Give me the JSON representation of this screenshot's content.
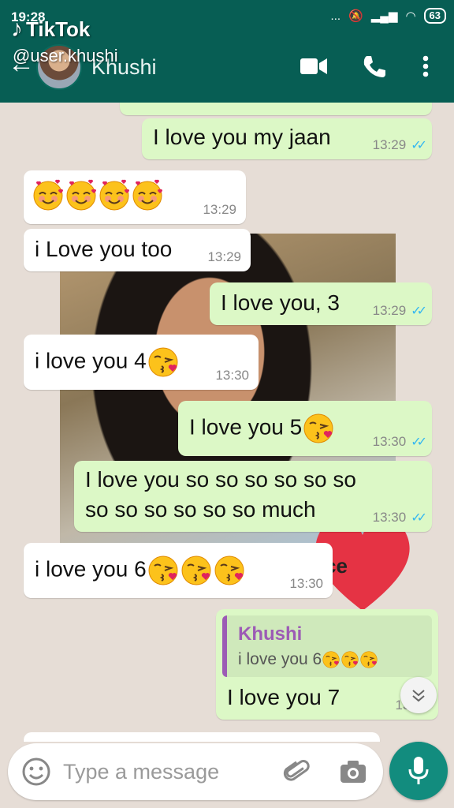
{
  "status_bar": {
    "time": "19:28",
    "signal": "...",
    "battery": "63"
  },
  "watermark": {
    "brand": "TikTok",
    "user": "@user.khushi"
  },
  "header": {
    "contact_name": "Khushi"
  },
  "photo_overlay_text": "ce",
  "messages": [
    {
      "direction": "out",
      "text": "I love you my jaan",
      "time": "13:29",
      "read": true
    },
    {
      "direction": "in",
      "text": "",
      "emoji": [
        "smiling-face-with-hearts",
        "smiling-face-with-hearts",
        "smiling-face-with-hearts",
        "smiling-face-with-hearts"
      ],
      "time": "13:29"
    },
    {
      "direction": "in",
      "text": "i Love you too",
      "time": "13:29"
    },
    {
      "direction": "out",
      "text": "I love you, 3",
      "time": "13:29",
      "read": true
    },
    {
      "direction": "in",
      "text": "i love you 4",
      "emoji": [
        "face-blowing-kiss"
      ],
      "time": "13:30"
    },
    {
      "direction": "out",
      "text": "I love you 5",
      "emoji": [
        "face-blowing-kiss"
      ],
      "time": "13:30",
      "read": true
    },
    {
      "direction": "out",
      "text_line1": "I love you so so so so so so",
      "text_line2": "so so so so so so much",
      "time": "13:30",
      "read": true
    },
    {
      "direction": "in",
      "text": "i love you 6",
      "emoji": [
        "face-blowing-kiss",
        "face-blowing-kiss",
        "face-blowing-kiss"
      ],
      "time": "13:30"
    },
    {
      "direction": "out",
      "quote_name": "Khushi",
      "quote_text": "i love you 6",
      "text": "I love you 7",
      "time": "13:30"
    }
  ],
  "input": {
    "placeholder": "Type a message"
  },
  "colors": {
    "header": "#075e54",
    "outgoing": "#dcf8c6",
    "incoming": "#ffffff",
    "accent": "#128c7e",
    "tick": "#34b7f1",
    "quote_bar": "#9c5bb5"
  },
  "icons": [
    "back-arrow-icon",
    "video-call-icon",
    "phone-icon",
    "more-vert-icon",
    "emoji-icon",
    "attach-icon",
    "camera-icon",
    "mic-icon",
    "chevron-down-icon"
  ]
}
